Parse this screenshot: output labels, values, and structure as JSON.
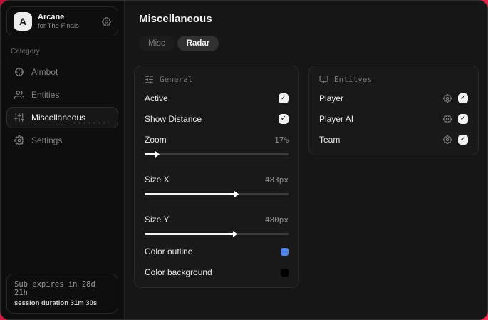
{
  "colors": {
    "outer_background": "#e0113d",
    "window_background": "#161616",
    "accent_checkbox": "#f1f1f1",
    "outline_swatch": "#4f83e8",
    "background_swatch": "#000000"
  },
  "sidebar": {
    "app": {
      "logo_letter": "A",
      "title": "Arcane",
      "subtitle": "for The Finals",
      "header_icon": "gear-icon"
    },
    "category_label": "Category",
    "items": [
      {
        "label": "Aimbot",
        "icon": "crosshair-icon",
        "active": false
      },
      {
        "label": "Entities",
        "icon": "users-icon",
        "active": false
      },
      {
        "label": "Miscellaneous",
        "icon": "sliders-icon",
        "active": true
      },
      {
        "label": "Settings",
        "icon": "gear-icon",
        "active": false
      }
    ],
    "footer": {
      "line1": "Sub expires in 28d 21h",
      "line2": "session duration 31m 30s"
    }
  },
  "main": {
    "title": "Miscellaneous",
    "tabs": [
      {
        "label": "Misc",
        "active": false
      },
      {
        "label": "Radar",
        "active": true
      }
    ],
    "panels": {
      "general": {
        "header": "General",
        "header_icon": "sliders-horizontal-icon",
        "toggles": [
          {
            "label": "Active",
            "checked": true
          },
          {
            "label": "Show Distance",
            "checked": true
          }
        ],
        "sliders": [
          {
            "label": "Zoom",
            "value": "17%",
            "fill": "6%"
          },
          {
            "label": "Size X",
            "value": "483px",
            "fill": "61%"
          },
          {
            "label": "Size Y",
            "value": "480px",
            "fill": "60%"
          }
        ],
        "colors": [
          {
            "label": "Color outline",
            "swatch": "#4f83e8"
          },
          {
            "label": "Color background",
            "swatch": "#000000"
          }
        ]
      },
      "entities": {
        "header": "Entityes",
        "header_icon": "monitor-icon",
        "rows": [
          {
            "label": "Player",
            "checked": true,
            "icon": "gear-icon"
          },
          {
            "label": "Player AI",
            "checked": true,
            "icon": "gear-icon"
          },
          {
            "label": "Team",
            "checked": true,
            "icon": "gear-icon"
          }
        ]
      }
    }
  }
}
